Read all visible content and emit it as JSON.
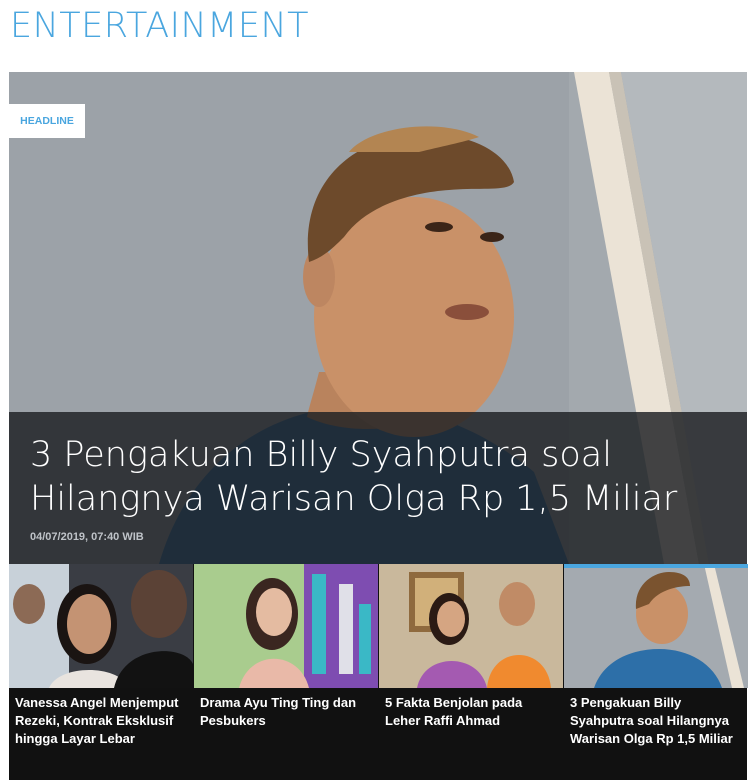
{
  "section": {
    "title": "ENTERTAINMENT"
  },
  "headline": {
    "badge": "HEADLINE",
    "title": "3 Pengakuan Billy Syahputra soal Hilangnya Warisan Olga Rp 1,5 Miliar",
    "date": "04/07/2019, 07:40 WIB"
  },
  "articles": [
    {
      "title": "Vanessa Angel Menjemput Rezeki, Kontrak Eksklusif hingga Layar Lebar"
    },
    {
      "title": "Drama Ayu Ting Ting dan Pesbukers"
    },
    {
      "title": "5 Fakta Benjolan pada Leher Raffi Ahmad"
    },
    {
      "title": "3 Pengakuan Billy Syahputra soal Hilangnya Warisan Olga Rp 1,5 Miliar"
    }
  ],
  "colors": {
    "accent": "#4aa6df",
    "caption_bg": "#1c1e22",
    "strip_bg": "#111111"
  }
}
